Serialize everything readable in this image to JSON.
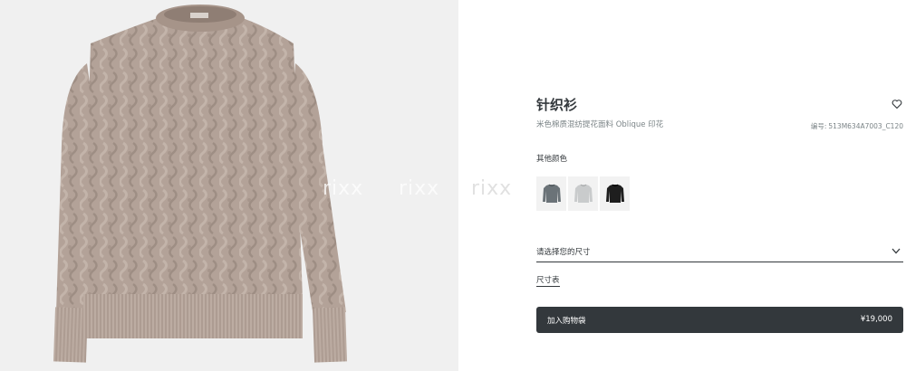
{
  "product": {
    "title": "针织衫",
    "subtitle": "米色棉质混纺提花面料 Oblique 印花",
    "ref_label": "编号:",
    "ref_value": "513M634A7003_C120",
    "main_color": "#b09f95"
  },
  "watermark": [
    "rixx",
    "rixx",
    "rixx"
  ],
  "colors": {
    "label": "其他颜色",
    "swatches": [
      {
        "name": "grey",
        "color": "#6b7378"
      },
      {
        "name": "light-grey",
        "color": "#c9cbcc"
      },
      {
        "name": "black",
        "color": "#1e1e1e"
      }
    ]
  },
  "size": {
    "placeholder": "请选择您的尺寸",
    "guide_label": "尺寸表"
  },
  "cart": {
    "label": "加入购物袋",
    "price": "¥19,000"
  },
  "icons": {
    "favorite": "heart-icon",
    "dropdown": "chevron-down-icon"
  }
}
